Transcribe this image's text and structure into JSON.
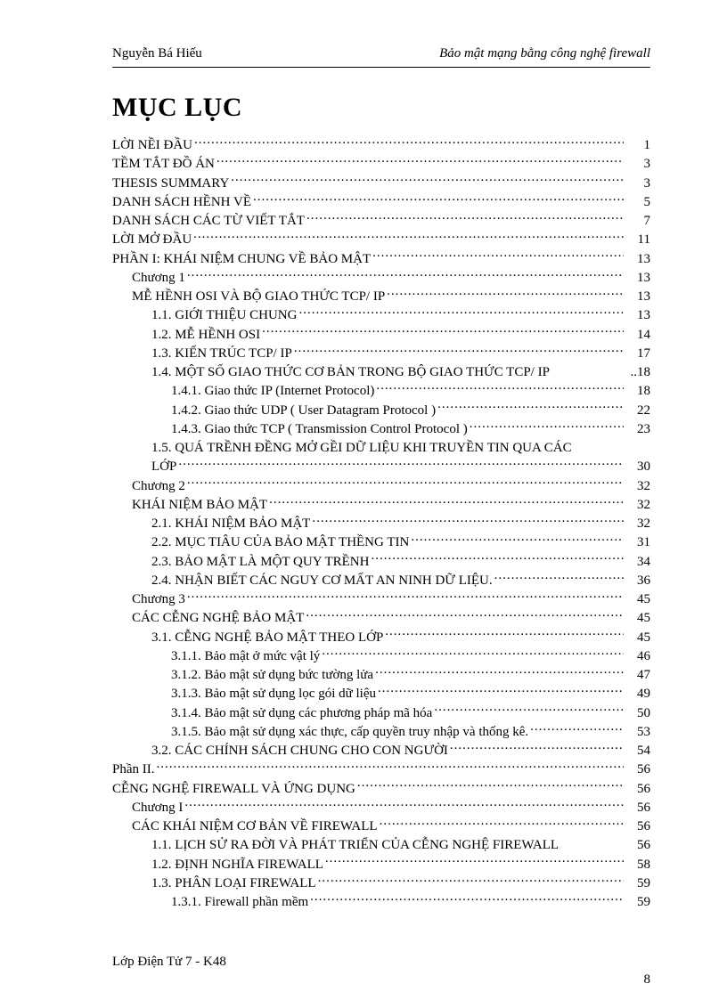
{
  "header": {
    "left": "Nguyễn Bá Hiếu",
    "right": "Bảo mật mạng bằng công nghệ firewall"
  },
  "title": "MỤC LỤC",
  "toc": [
    {
      "indent": 0,
      "label": "LỜI NỀI ĐẦU",
      "page": "1"
    },
    {
      "indent": 0,
      "label": "TỀM TẮT ĐỒ ÁN",
      "page": "3"
    },
    {
      "indent": 0,
      "label": "THESIS  SUMMARY",
      "page": "3"
    },
    {
      "indent": 0,
      "label": "DANH SÁCH HỀNH VỀ",
      "page": "5"
    },
    {
      "indent": 0,
      "label": "DANH SÁCH CÁC TỪ VIẾT TẮT",
      "page": "7"
    },
    {
      "indent": 0,
      "label": "LỜI MỞ ĐẦU",
      "page": "11"
    },
    {
      "indent": 0,
      "label": "PHẦN I: KHÁI NIỆM CHUNG VỀ BẢO MẬT",
      "page": "13"
    },
    {
      "indent": 1,
      "label": "Chương 1",
      "page": "13"
    },
    {
      "indent": 1,
      "label": "MỄ HỀNH OSI VÀ BỘ GIAO THỨC TCP/ IP",
      "page": "13"
    },
    {
      "indent": 2,
      "label": "1.1. GIỚI THIỆU  CHUNG",
      "page": "13"
    },
    {
      "indent": 2,
      "label": "1.2. MỄ HỀNH OSI",
      "page": "14"
    },
    {
      "indent": 2,
      "label": "1.3. KIẾN TRÚC TCP/ IP",
      "page": "17"
    },
    {
      "indent": 2,
      "label": "1.4. MỘT SỐ GIAO THỨC CƠ BẢN TRONG BỘ GIAO THỨC TCP/ IP",
      "page": "..18",
      "noLeader": true
    },
    {
      "indent": 3,
      "label": "1.4.1. Giao thức IP (Internet Protocol)",
      "page": "18"
    },
    {
      "indent": 3,
      "label": "1.4.2. Giao thức UDP ( User Datagram Protocol )",
      "page": "22"
    },
    {
      "indent": 3,
      "label": "1.4.3. Giao thức TCP ( Transmission Control Protocol )",
      "page": "23"
    },
    {
      "indent": 2,
      "label": "1.5. QUÁ TRỀNH ĐỀNG MỞ GỀI DỮ LIỆU KHI TRUYỀN  TIN QUA CÁC",
      "page": "",
      "noLeader": true
    },
    {
      "indent": 2,
      "label": "LỚP",
      "page": "30"
    },
    {
      "indent": 1,
      "label": "Chương 2",
      "page": "32"
    },
    {
      "indent": 1,
      "label": "KHÁI NIỆM BẢO MẬT",
      "page": "32"
    },
    {
      "indent": 2,
      "label": "2.1. KHÁI NIỆM BẢO MẬT",
      "page": "32"
    },
    {
      "indent": 2,
      "label": "2.2. MỤC TIÂU CỦA BẢO MẬT THỀNG TIN",
      "page": "31"
    },
    {
      "indent": 2,
      "label": "2.3. BẢO MẬT LÀ MỘT QUY TRỀNH",
      "page": "34"
    },
    {
      "indent": 2,
      "label": "2.4. NHẬN BIẾT CÁC NGUY CƠ MẤT AN NINH DỮ LIỆU.",
      "page": "36"
    },
    {
      "indent": 1,
      "label": "Chương 3",
      "page": "45"
    },
    {
      "indent": 1,
      "label": "CÁC CỄNG NGHỆ BẢO MẬT",
      "page": "45"
    },
    {
      "indent": 2,
      "label": "3.1. CỄNG NGHỆ BẢO MẬT THEO LỚP",
      "page": "45"
    },
    {
      "indent": 3,
      "label": "3.1.1. Bảo mật ở mức vật lý",
      "page": "46"
    },
    {
      "indent": 3,
      "label": "3.1.2. Bảo mật sử dụng bức tường lửa",
      "page": "47"
    },
    {
      "indent": 3,
      "label": "3.1.3. Bảo mật sử dụng lọc gói dữ liệu",
      "page": "49"
    },
    {
      "indent": 3,
      "label": "3.1.4. Bảo mật sử dụng các phương pháp mã hóa",
      "page": "50"
    },
    {
      "indent": 3,
      "label": "3.1.5. Bảo mật sử dụng xác thực, cấp quyền truy nhập và thống kê.",
      "page": "53"
    },
    {
      "indent": 2,
      "label": "3.2. CÁC CHÍNH SÁCH CHUNG CHO CON NGƯỜI",
      "page": "54"
    },
    {
      "indent": 0,
      "label": "Phần II.",
      "page": "56"
    },
    {
      "indent": 0,
      "label": "CỄNG NGHỆ FIREWALL  VÀ ỨNG DỤNG",
      "page": "56"
    },
    {
      "indent": 1,
      "label": "Chương I",
      "page": "56"
    },
    {
      "indent": 1,
      "label": "CÁC KHÁI NIỆM CƠ BẢN VỀ FIREWALL",
      "page": "56"
    },
    {
      "indent": 2,
      "label": "1.1. LỊCH SỬ RA ĐỜI VÀ PHÁT TRIỂN CỦA CỄNG NGHỆ FIREWALL",
      "page": "56",
      "noLeader": true
    },
    {
      "indent": 2,
      "label": "1.2. ĐỊNH NGHĨA FIREWALL",
      "page": "58"
    },
    {
      "indent": 2,
      "label": "1.3. PHÂN LOẠI FIREWALL",
      "page": "59"
    },
    {
      "indent": 3,
      "label": "1.3.1. Firewall phần mềm",
      "page": "59"
    }
  ],
  "footer": {
    "left": "Lớp Điện Tử 7 - K48",
    "page": "8"
  }
}
